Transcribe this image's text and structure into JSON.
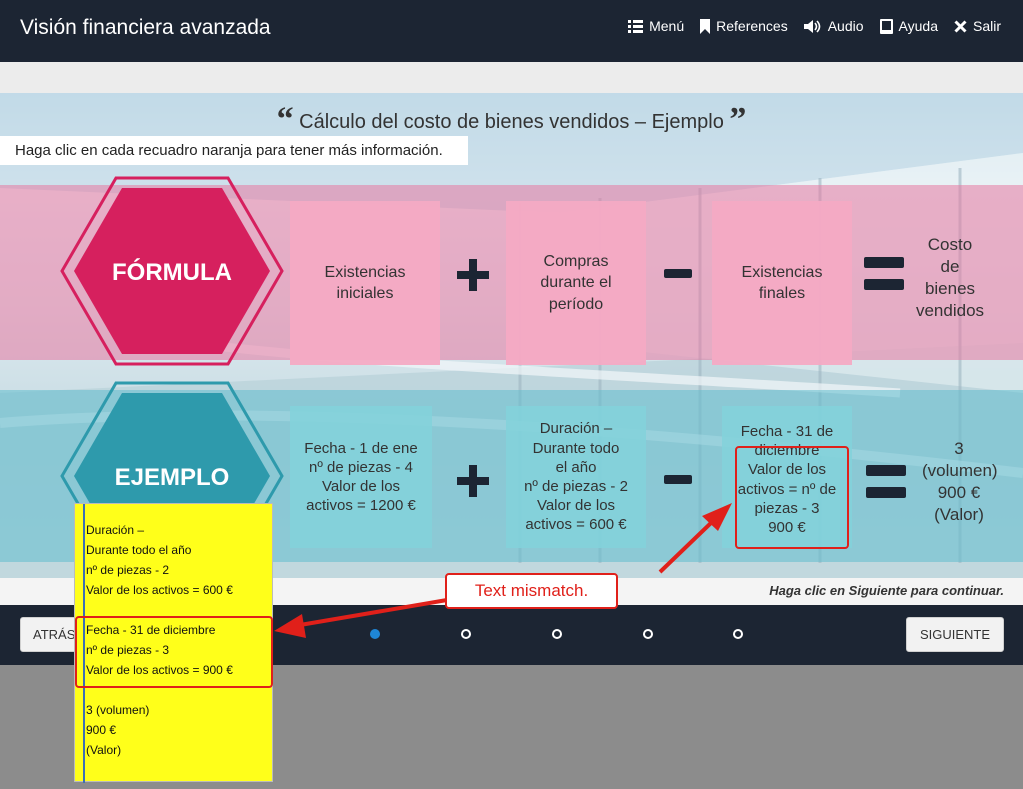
{
  "app": {
    "title": "Visión financiera avanzada"
  },
  "nav": {
    "menu": "Menú",
    "references": "References",
    "audio": "Audio",
    "help": "Ayuda",
    "exit": "Salir"
  },
  "slide": {
    "title": "Cálculo del costo de bienes vendidos – Ejemplo",
    "instruction": "Haga clic en cada recuadro naranja para tener más información.",
    "formula": {
      "label": "FÓRMULA",
      "box1": "Existencias\niniciales",
      "box2": "Compras\ndurante el\nperíodo",
      "box3": "Existencias\nfinales",
      "result": "Costo\nde\nbienes\nvendidos"
    },
    "example": {
      "label": "EJEMPLO",
      "box1": "Fecha - 1 de ene\nnº de piezas - 4\nValor de los\nactivos = 1200 €",
      "box2": "Duración –\nDurante todo\nel año\nnº de piezas - 2\nValor de los\nactivos = 600 €",
      "box3": "Fecha - 31 de\ndiciembre\nValor de los\nactivos = nº de\npiezas - 3\n900 €",
      "result": "3\n(volumen)\n900 €\n(Valor)"
    },
    "continue_hint": "Haga clic en Siguiente para continuar."
  },
  "footer": {
    "back": "ATRÁS",
    "next": "SIGUIENTE",
    "pages": 5,
    "current_page": 1
  },
  "annotation": {
    "lines": [
      "Duración –",
      "Durante todo el año",
      "nº de piezas - 2",
      "Valor de los activos = 600 €",
      "Fecha - 31 de diciembre",
      "nº de piezas - 3",
      "Valor de los activos = 900 €",
      "3 (volumen)",
      "900 €",
      "(Valor)"
    ],
    "tag": "Text mismatch."
  },
  "colors": {
    "header": "#1c2533",
    "formula": "#d6205e",
    "example": "#2e9aac",
    "accent": "#1e86d6",
    "annotation": "#e0201a"
  }
}
